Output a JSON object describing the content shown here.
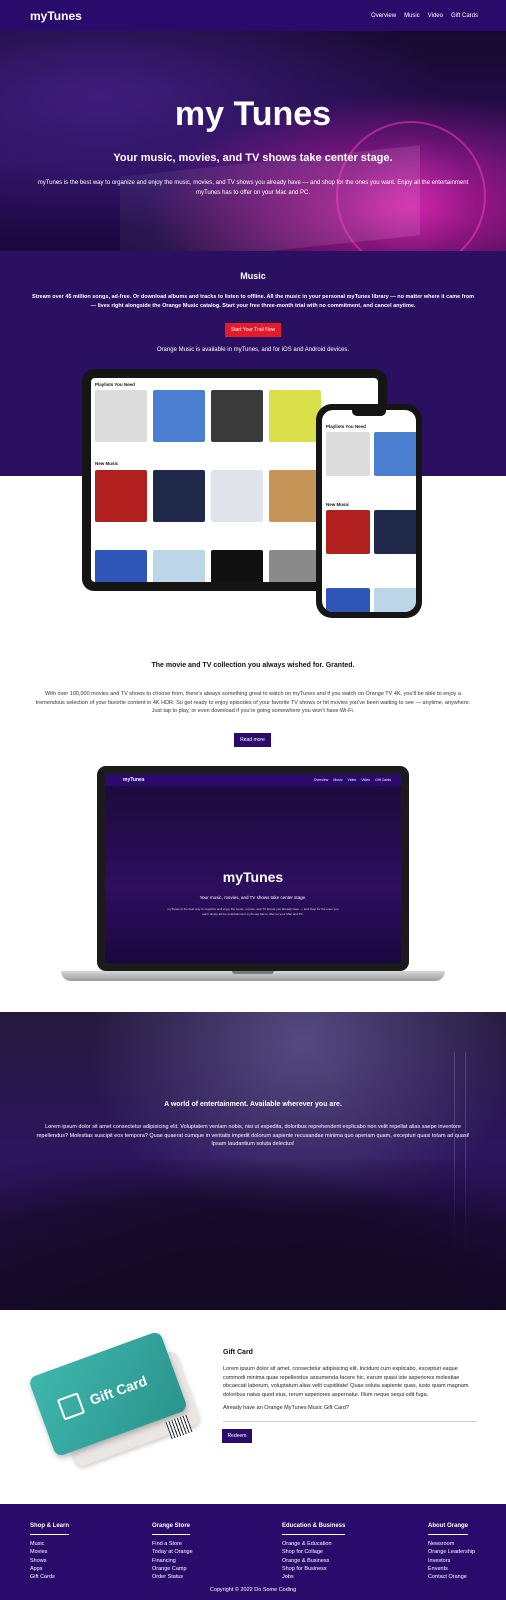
{
  "nav": {
    "brand": "myTunes",
    "links": [
      "Overview",
      "Music",
      "Video",
      "Gift Cards"
    ]
  },
  "hero": {
    "title": "my Tunes",
    "subtitle": "Your music, movies, and TV shows take center stage.",
    "description": "myTunes is the best way to organize and enjoy the music, movies, and TV shows you already have — and shop for the ones you want. Enjoy all the entertainment myTunes has to offer on your Mac and PC."
  },
  "music": {
    "title": "Music",
    "description": "Stream over 45 million songs, ad-free. Or download albums and tracks to listen to offline. All the music in your personal myTunes library — no matter where it came from — lives right alongside the Orange Music catalog. Start your free three-month trial with no commitment, and cancel anytime.",
    "trial_button": "Start Your Trail Now",
    "availability": "Orange Music is available in myTunes, and for iOS and Android devices."
  },
  "devices": {
    "tablet_section_1": "Playlists You Need",
    "tablet_section_2": "New Music",
    "phone_section_1": "Playlists You Need",
    "phone_section_2": "New Music",
    "tile_caption": "",
    "tablet_tiles": [
      {
        "color": "#dcdcdc"
      },
      {
        "color": "#4a7fd0"
      },
      {
        "color": "#3a3a3a"
      },
      {
        "color": "#d9e04a"
      },
      {
        "color": "#b11f1f"
      },
      {
        "color": "#1f2a4a"
      },
      {
        "color": "#e0e3ea"
      },
      {
        "color": "#c49556"
      },
      {
        "color": "#2d56b8"
      },
      {
        "color": "#bcd6e8"
      },
      {
        "color": "#101010"
      },
      {
        "color": "#8a8a8a"
      }
    ],
    "phone_tiles": [
      {
        "color": "#dcdcdc"
      },
      {
        "color": "#4a7fd0"
      },
      {
        "color": "#b11f1f"
      },
      {
        "color": "#1f2a4a"
      },
      {
        "color": "#2d56b8"
      },
      {
        "color": "#bcd6e8"
      }
    ]
  },
  "movies": {
    "title": "The movie and TV collection you always wished for. Granted.",
    "description": "With over 100,000 movies and TV shows to choose from, there's always something great to watch on myTunes and if you watch on Orange TV 4K, you'll be able to enjoy a tremendous selection of your favorite content in 4K HDR. So get ready to enjoy episodes of your favorite TV shows or hit movies you've been waiting to see — anytime, anywhere. Just tap to play, or even download if you're going somewhere you won't have Wi-Fi.",
    "read_more": "Read more"
  },
  "laptop": {
    "brand": "myTunes",
    "links": [
      "Overview",
      "Music",
      "Video",
      "Video",
      "Gift Cards"
    ],
    "title": "myTunes",
    "subtitle": "Your music, movies, and TV shows take center stage.",
    "description": "myTunes is the best way to organize and enjoy the music, movies, and TV shows you already have — and shop for the ones you want. Enjoy all the entertainment myTunes has to offer on your Mac and PC."
  },
  "entertainment": {
    "title": "A world of entertainment. Available wherever you are.",
    "description": "Lorem ipsum dolor sit amet consectetur adipisicing elit. Voluptatem veniam nobis, nisi ut expedita, doloribus reprehenderit explicabo non velit repellat alias saepe inventore repellendus? Molestias suscipit eos tempora? Quae quaerat cumque in veritatis impedit dolorum sapiente recusandae minima quo aperiam quam, excepturi quasi totam ad quasi! Ipsam laudantium soluta delectus!"
  },
  "gift": {
    "card_label": "Gift Card",
    "title": "Gift Card",
    "description": "Lorem ipsum dolor sit amet, consectetur adipisicing elit. Incidunt cum explicabo, excepturi eaque commodi minima quae repellendus assumenda facere hic, earum quasi iste asperiores molestiae obcaecati laborum, voluptatum alias velit cupiditate! Quae soluta sapiente quas, iusto quam magnam doloribus natus quod eius, rerum asperiores aspernatur. Illum neque sequi odit fuga.",
    "question": "Already have an Orange MyTunes Music Gift Card?",
    "redeem": "Redeem"
  },
  "footer": {
    "columns": [
      {
        "title": "Shop & Learn",
        "items": [
          "Music",
          "Movies",
          "Shows",
          "Apps",
          "Gift Cards"
        ]
      },
      {
        "title": "Orange Store",
        "items": [
          "Find a Store",
          "Today at Orange",
          "Financing",
          "Orange Camp",
          "Order Status"
        ]
      },
      {
        "title": "Education & Business",
        "items": [
          "Orange & Education",
          "Shop for Collage",
          "Orange & Business",
          "Shop for Business",
          "Jobs"
        ]
      },
      {
        "title": "About Orange",
        "items": [
          "Newsroom",
          "Orange Leadership",
          "Investors",
          "Envents",
          "Contact Orange"
        ]
      }
    ],
    "copyright": "Copyright © 2022 Do Some Coding"
  }
}
